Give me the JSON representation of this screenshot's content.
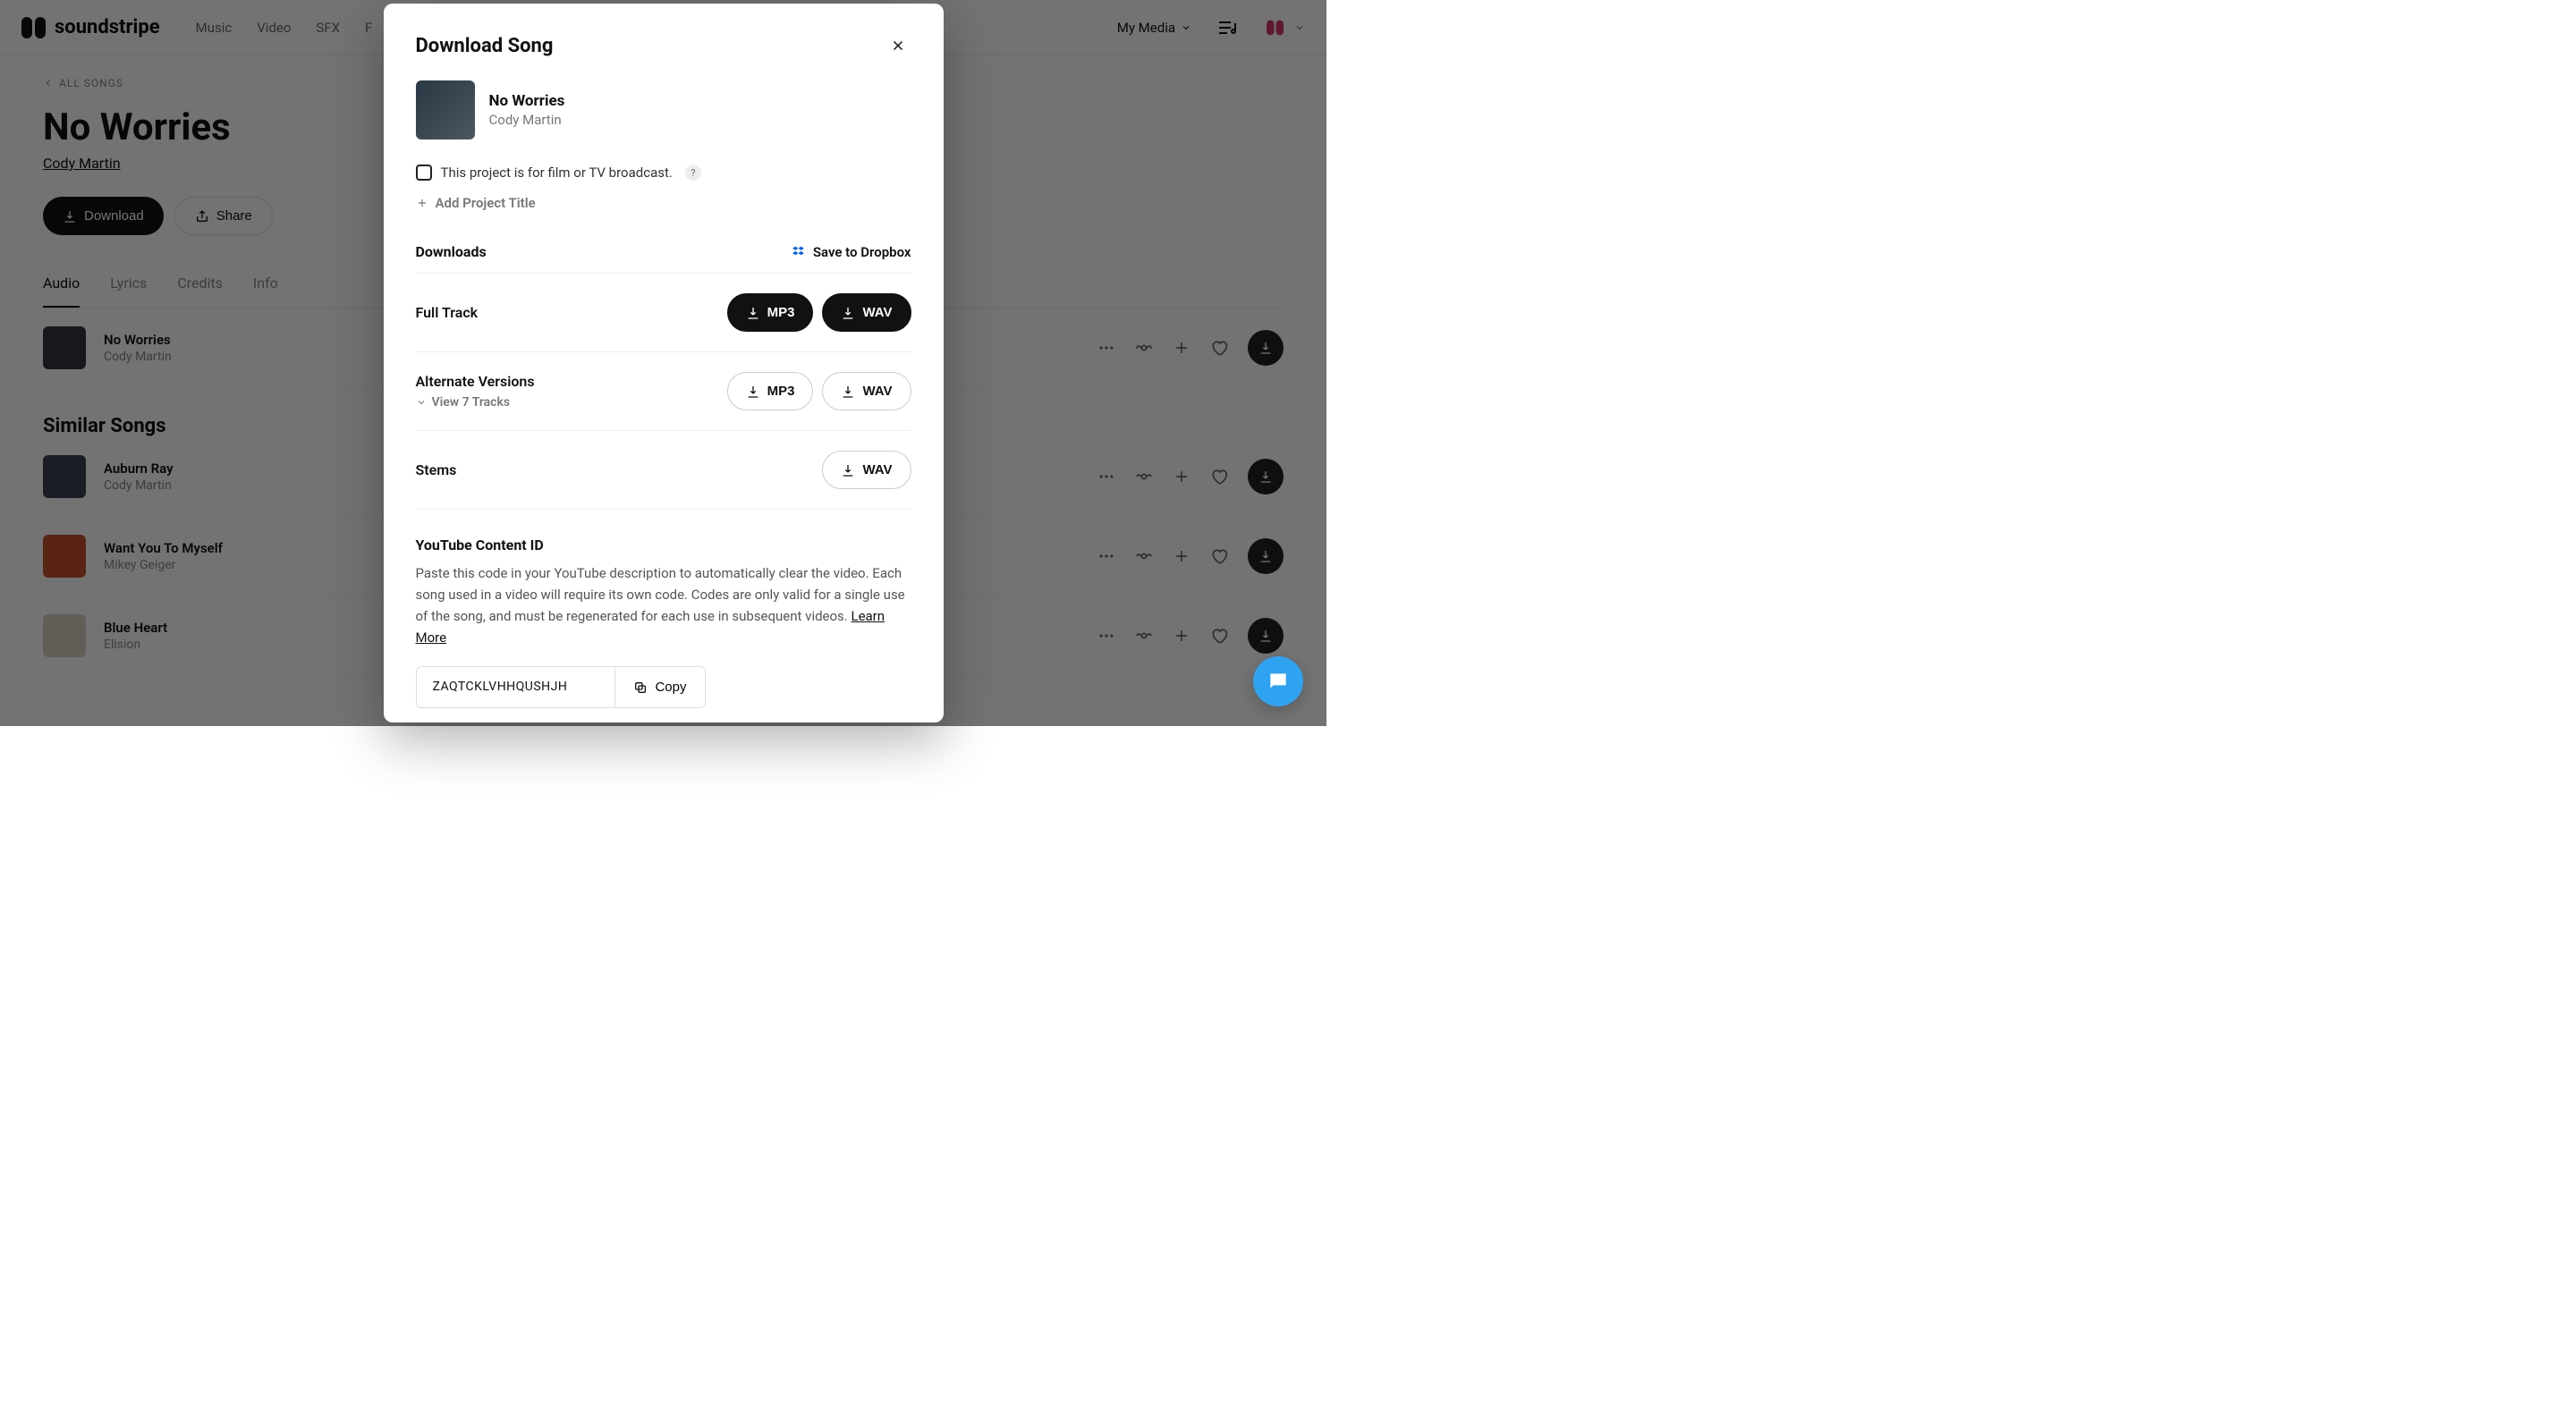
{
  "header": {
    "brand": "soundstripe",
    "nav": [
      "Music",
      "Video",
      "SFX",
      "F"
    ],
    "my_media": "My Media"
  },
  "page": {
    "back_label": "ALL SONGS",
    "title": "No Worries",
    "artist": "Cody Martin",
    "download_btn": "Download",
    "share_btn": "Share",
    "tabs": {
      "audio": "Audio",
      "lyrics": "Lyrics",
      "credits": "Credits",
      "info": "Info"
    },
    "current_track": {
      "title": "No Worries",
      "artist": "Cody Martin"
    },
    "similar_heading": "Similar Songs",
    "similar": [
      {
        "title": "Auburn Ray",
        "artist": "Cody Martin"
      },
      {
        "title": "Want You To Myself",
        "artist": "Mikey Geiger"
      },
      {
        "title": "Blue Heart",
        "artist": "Elision"
      }
    ]
  },
  "modal": {
    "title": "Download Song",
    "song": {
      "title": "No Worries",
      "artist": "Cody Martin"
    },
    "film_tv_label": "This project is for film or TV broadcast.",
    "add_project": "Add Project Title",
    "downloads_label": "Downloads",
    "dropbox_label": "Save to Dropbox",
    "rows": {
      "full_track": {
        "label": "Full Track",
        "mp3": "MP3",
        "wav": "WAV"
      },
      "alt": {
        "label": "Alternate Versions",
        "view": "View 7 Tracks",
        "mp3": "MP3",
        "wav": "WAV"
      },
      "stems": {
        "label": "Stems",
        "wav": "WAV"
      }
    },
    "yt": {
      "heading": "YouTube Content ID",
      "desc": "Paste this code in your YouTube description to automatically clear the video. Each song used in a video will require its own code. Codes are only valid for a single use of the song, and must be regenerated for each use in subsequent videos. ",
      "learn_more": "Learn More",
      "code": "ZAQTCKLVHHQUSHJH",
      "copy": "Copy"
    }
  }
}
